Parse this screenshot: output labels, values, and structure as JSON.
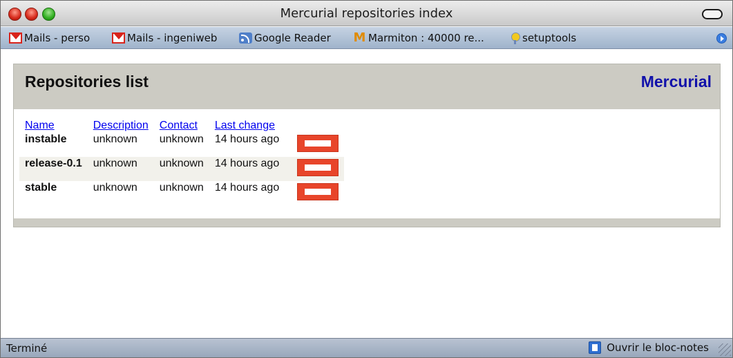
{
  "window": {
    "title": "Mercurial repositories index"
  },
  "bookmarks": [
    {
      "label": "Mails - perso",
      "icon": "gmail-icon"
    },
    {
      "label": "Mails - ingeniweb",
      "icon": "gmail-icon"
    },
    {
      "label": "Google Reader",
      "icon": "rss-icon"
    },
    {
      "label": "Marmiton : 40000 re...",
      "icon": "marmiton-icon"
    },
    {
      "label": "setuptools",
      "icon": "setuptools-icon"
    }
  ],
  "page": {
    "heading": "Repositories list",
    "brand_link": "Mercurial"
  },
  "table": {
    "columns": [
      "Name",
      "Description",
      "Contact",
      "Last change"
    ],
    "rows": [
      {
        "name": "instable",
        "description": "unknown",
        "contact": "unknown",
        "last_change": "14 hours ago"
      },
      {
        "name": "release-0.1",
        "description": "unknown",
        "contact": "unknown",
        "last_change": "14 hours ago"
      },
      {
        "name": "stable",
        "description": "unknown",
        "contact": "unknown",
        "last_change": "14 hours ago"
      }
    ]
  },
  "statusbar": {
    "status": "Terminé",
    "notes_button": "Ouvrir le bloc-notes"
  },
  "colors": {
    "panel_header": "#cccbc3",
    "brand_link": "#1111aa",
    "rss_button": "#e8452a",
    "bookmarks_bar": "#a9bbd1"
  }
}
